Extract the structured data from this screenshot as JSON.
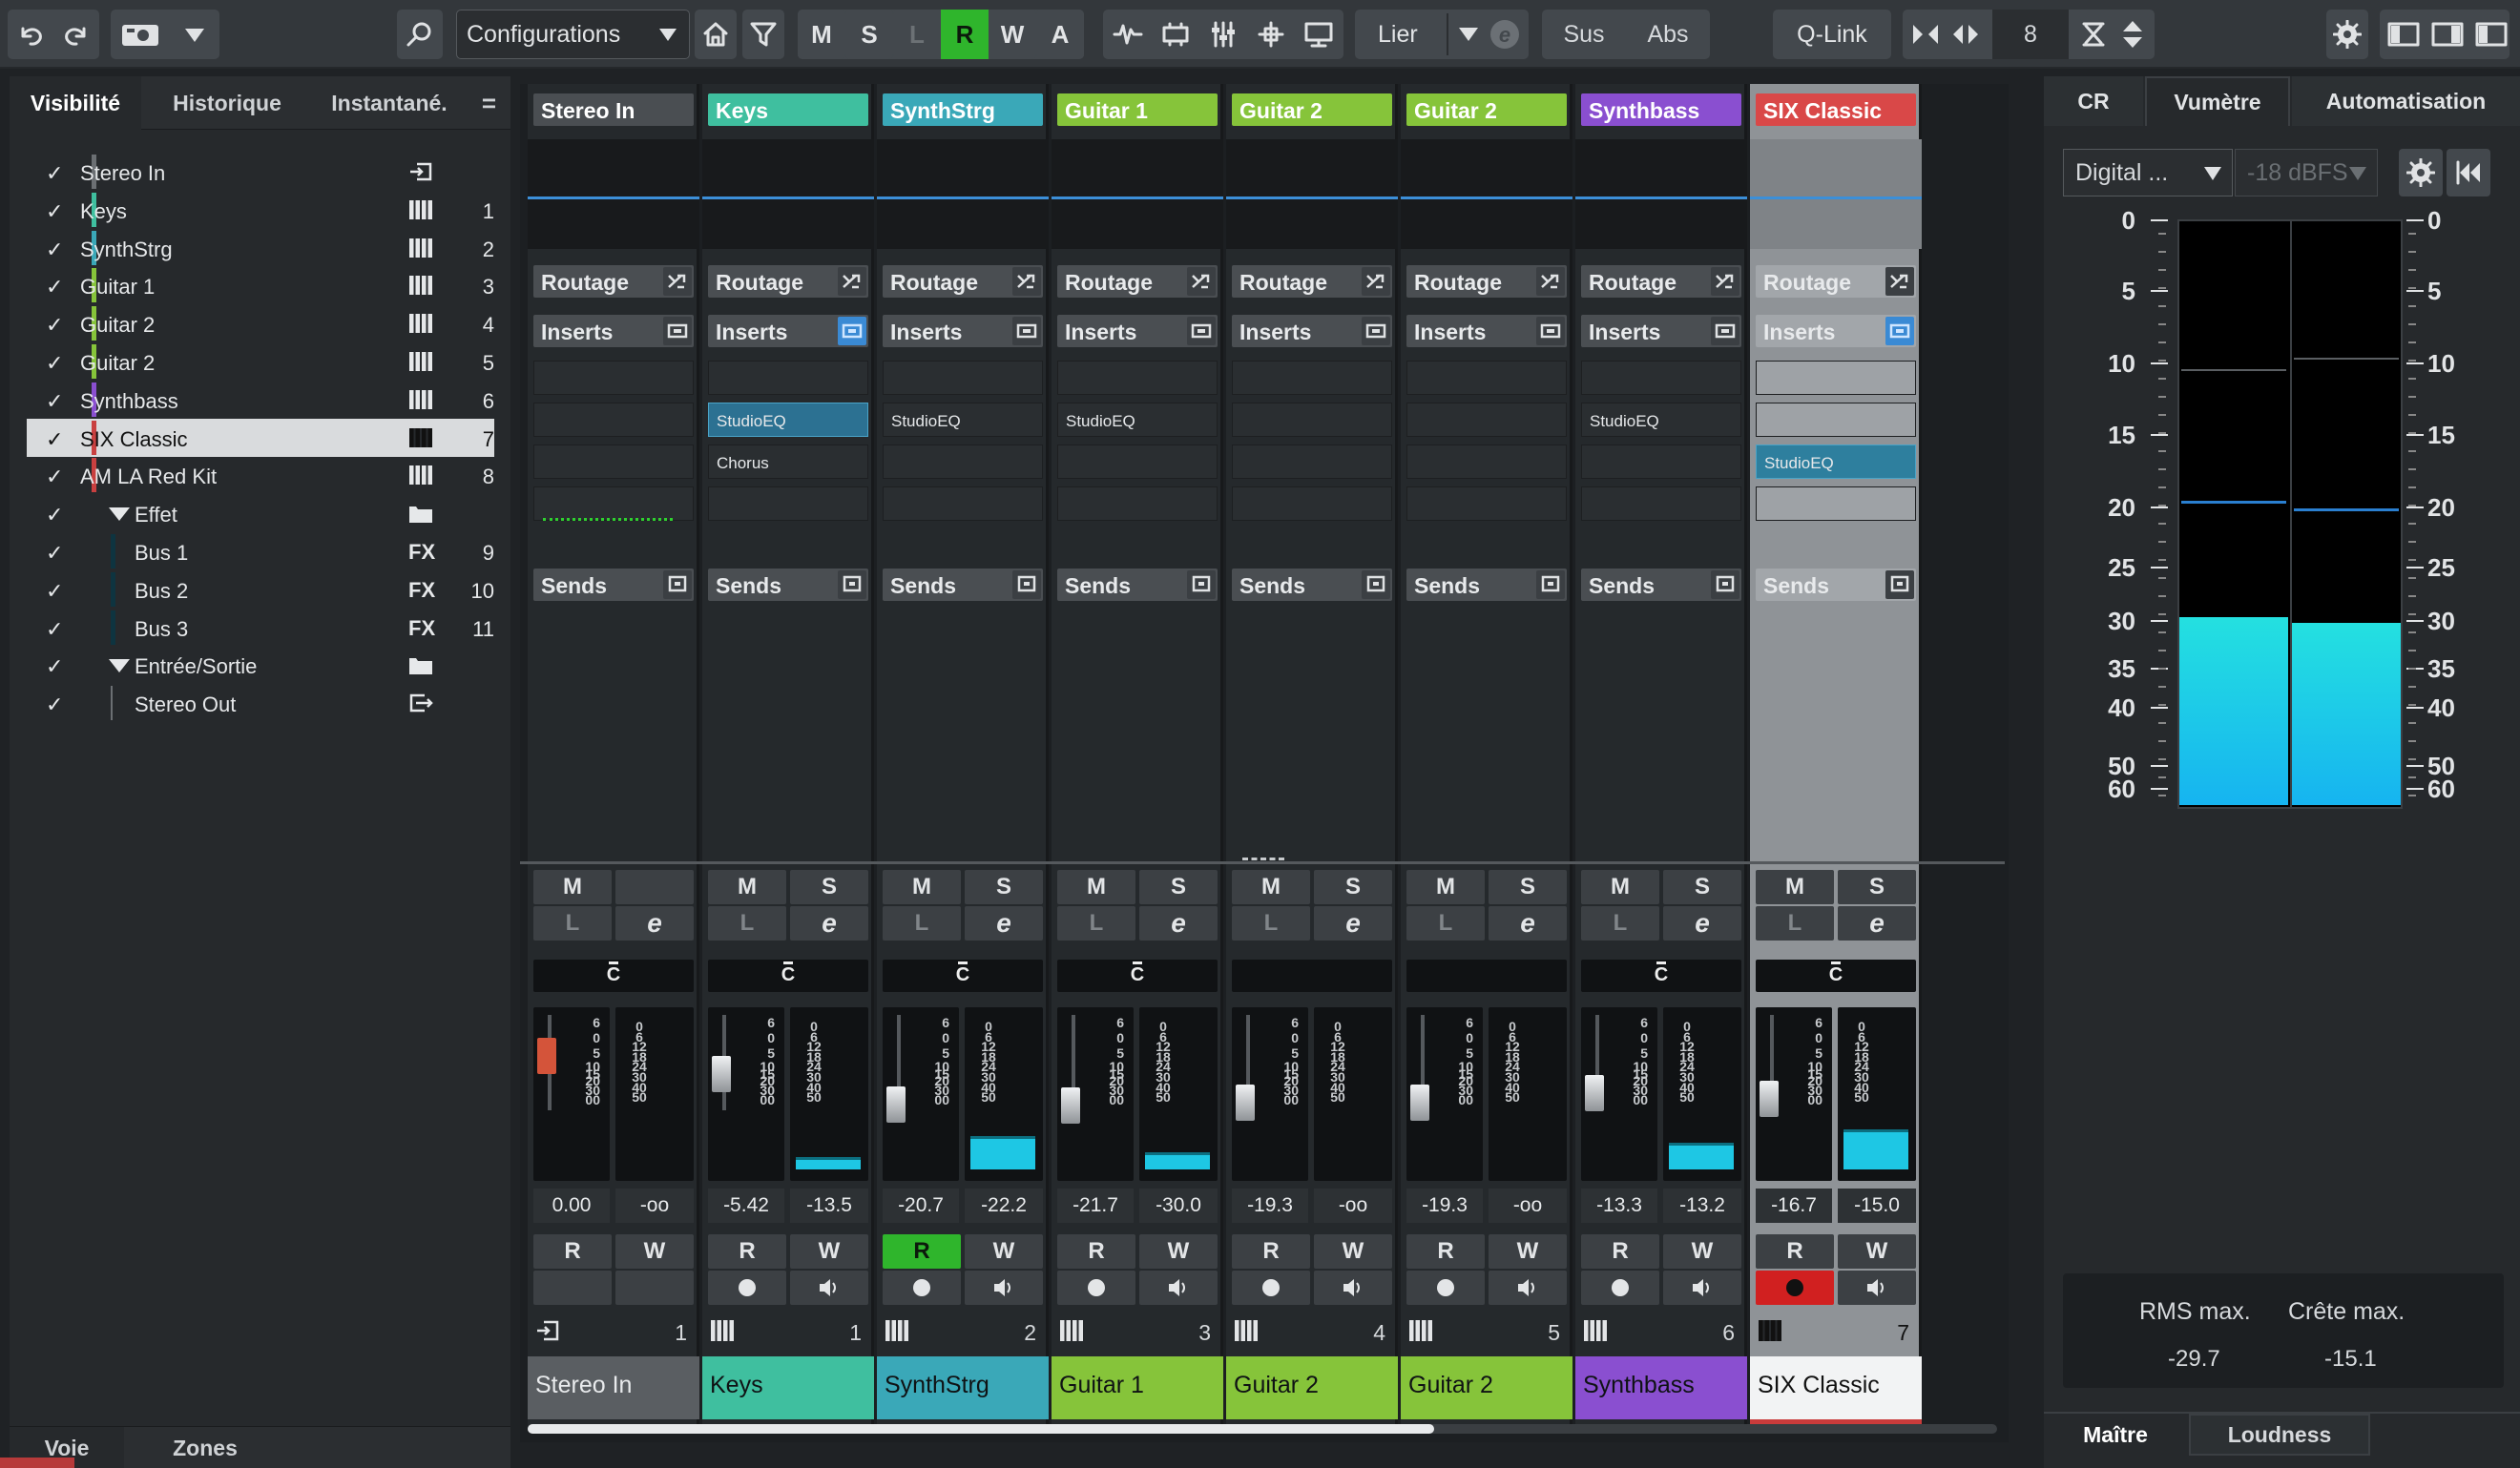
{
  "toolbar": {
    "configurations": "Configurations",
    "m": "M",
    "s": "S",
    "l": "L",
    "r": "R",
    "w": "W",
    "a": "A",
    "link": "Lier",
    "sus": "Sus",
    "abs": "Abs",
    "qlink": "Q-Link",
    "count": "8"
  },
  "left_panel": {
    "tabs": [
      "Visibilité",
      "Historique",
      "Instantané.",
      "="
    ],
    "tracks": [
      {
        "name": "Stereo In",
        "color": "#6b6f73",
        "icon": "input-icon",
        "num": "",
        "indent": 0
      },
      {
        "name": "Keys",
        "color": "#3fbf9f",
        "icon": "piano-icon",
        "num": "1",
        "indent": 0
      },
      {
        "name": "SynthStrg",
        "color": "#3aa8b8",
        "icon": "piano-icon",
        "num": "2",
        "indent": 0
      },
      {
        "name": "Guitar 1",
        "color": "#86c43a",
        "icon": "piano-icon",
        "num": "3",
        "indent": 0
      },
      {
        "name": "Guitar 2",
        "color": "#86c43a",
        "icon": "piano-icon",
        "num": "4",
        "indent": 0
      },
      {
        "name": "Guitar 2",
        "color": "#86c43a",
        "icon": "piano-icon",
        "num": "5",
        "indent": 0
      },
      {
        "name": "Synthbass",
        "color": "#8a4fd0",
        "icon": "piano-icon",
        "num": "6",
        "indent": 0
      },
      {
        "name": "SIX Classic",
        "color": "#c94040",
        "icon": "piano-icon",
        "num": "7",
        "indent": 0,
        "selected": true
      },
      {
        "name": "AM LA Red Kit",
        "color": "#c94040",
        "icon": "piano-icon",
        "num": "8",
        "indent": 0
      },
      {
        "name": "Effet",
        "color": "",
        "icon": "folder-icon",
        "num": "",
        "indent": 1,
        "folder": true
      },
      {
        "name": "Bus 1",
        "color": "#0e3440",
        "icon": "fx-icon",
        "num": "9",
        "indent": 1
      },
      {
        "name": "Bus 2",
        "color": "#0e3440",
        "icon": "fx-icon",
        "num": "10",
        "indent": 1
      },
      {
        "name": "Bus 3",
        "color": "#0e3440",
        "icon": "fx-icon",
        "num": "11",
        "indent": 1
      },
      {
        "name": "Entrée/Sortie",
        "color": "",
        "icon": "folder-icon",
        "num": "",
        "indent": 1,
        "folder": true
      },
      {
        "name": "Stereo Out",
        "color": "",
        "icon": "output-icon",
        "num": "",
        "indent": 1
      }
    ],
    "bottom_tabs": [
      "Voie",
      "Zones"
    ],
    "check": "✓",
    "fx": "FX"
  },
  "mixer": {
    "labels": {
      "routing": "Routage",
      "inserts": "Inserts",
      "sends": "Sends",
      "m": "M",
      "s": "S",
      "l": "L",
      "r": "R",
      "w": "W",
      "pan": "C"
    },
    "channels": [
      {
        "name": "Stereo In",
        "color": "#5a5e62",
        "num": "1",
        "fader": "0.00",
        "peak": "-oo",
        "inserts": [
          "",
          "",
          "",
          ""
        ],
        "pan": "C",
        "type": "input",
        "fader_db": 0,
        "meter": 0,
        "read": false,
        "rec": false
      },
      {
        "name": "Keys",
        "color": "#3fbf9f",
        "num": "1",
        "fader": "-5.42",
        "peak": "-13.5",
        "inserts": [
          "",
          "StudioEQ",
          "Chorus",
          ""
        ],
        "pan": "C",
        "type": "inst",
        "fader_db": -5.42,
        "meter": 0.13,
        "read": false,
        "rec": false
      },
      {
        "name": "SynthStrg",
        "color": "#3aa8b8",
        "num": "2",
        "fader": "-20.7",
        "peak": "-22.2",
        "inserts": [
          "",
          "StudioEQ",
          "",
          ""
        ],
        "pan": "C",
        "type": "inst",
        "fader_db": -20.7,
        "meter": 0.35,
        "read": true,
        "rec": false
      },
      {
        "name": "Guitar 1",
        "color": "#86c43a",
        "num": "3",
        "fader": "-21.7",
        "peak": "-30.0",
        "inserts": [
          "",
          "StudioEQ",
          "",
          ""
        ],
        "pan": "C",
        "type": "inst",
        "fader_db": -21.7,
        "meter": 0.18,
        "read": false,
        "rec": false
      },
      {
        "name": "Guitar 2",
        "color": "#86c43a",
        "num": "4",
        "fader": "-19.3",
        "peak": "-oo",
        "inserts": [
          "",
          "",
          "",
          ""
        ],
        "pan": "",
        "type": "inst",
        "fader_db": -19.3,
        "meter": 0,
        "read": false,
        "rec": false
      },
      {
        "name": "Guitar 2",
        "color": "#86c43a",
        "num": "5",
        "fader": "-19.3",
        "peak": "-oo",
        "inserts": [
          "",
          "",
          "",
          ""
        ],
        "pan": "",
        "type": "inst",
        "fader_db": -19.3,
        "meter": 0,
        "read": false,
        "rec": false
      },
      {
        "name": "Synthbass",
        "color": "#8a4fd0",
        "num": "6",
        "fader": "-13.3",
        "peak": "-13.2",
        "inserts": [
          "",
          "StudioEQ",
          "",
          ""
        ],
        "pan": "C",
        "type": "inst",
        "fader_db": -13.3,
        "meter": 0.28,
        "read": false,
        "rec": false
      },
      {
        "name": "SIX Classic",
        "color": "#d94848",
        "num": "7",
        "fader": "-16.7",
        "peak": "-15.0",
        "inserts": [
          "",
          "",
          "StudioEQ",
          ""
        ],
        "pan": "C",
        "type": "inst",
        "fader_db": -16.7,
        "meter": 0.42,
        "read": false,
        "rec": true,
        "selected": true
      }
    ],
    "fader_scale": [
      "6",
      "0",
      "5",
      "10",
      "15",
      "20",
      "30",
      "00"
    ],
    "meter_scale": [
      "0",
      "6",
      "12",
      "18",
      "24",
      "30",
      "40",
      "50"
    ]
  },
  "right_panel": {
    "tabs": [
      "CR",
      "Vumètre",
      "Automatisation"
    ],
    "mode": "Digital ...",
    "ref": "-18 dBFS",
    "scale": [
      "0",
      "5",
      "10",
      "15",
      "20",
      "25",
      "30",
      "35",
      "40",
      "50",
      "60"
    ],
    "rms_label": "RMS max.",
    "crest_label": "Crête max.",
    "rms_value": "-29.7",
    "crest_value": "-15.1",
    "level_l_db": -29.7,
    "level_r_db": -30.3,
    "bottom_tabs": [
      "Maître",
      "Loudness"
    ]
  }
}
